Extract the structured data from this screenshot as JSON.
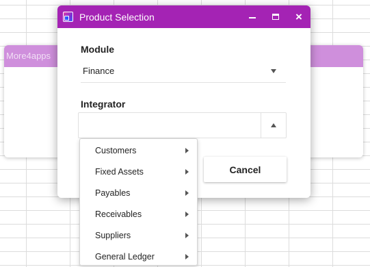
{
  "background_dialog": {
    "title": "More4apps"
  },
  "dialog": {
    "title": "Product Selection",
    "accent_color": "#a423b4",
    "window_buttons": {
      "minimize": "minimize-icon",
      "maximize": "maximize-icon",
      "close": "×"
    },
    "module": {
      "label": "Module",
      "value": "Finance"
    },
    "integrator": {
      "label": "Integrator",
      "value": "",
      "placeholder": ""
    },
    "cancel_label": "Cancel"
  },
  "menu": {
    "items": [
      {
        "label": "Customers"
      },
      {
        "label": "Fixed Assets"
      },
      {
        "label": "Payables"
      },
      {
        "label": "Receivables"
      },
      {
        "label": "Suppliers"
      },
      {
        "label": "General Ledger"
      }
    ]
  }
}
